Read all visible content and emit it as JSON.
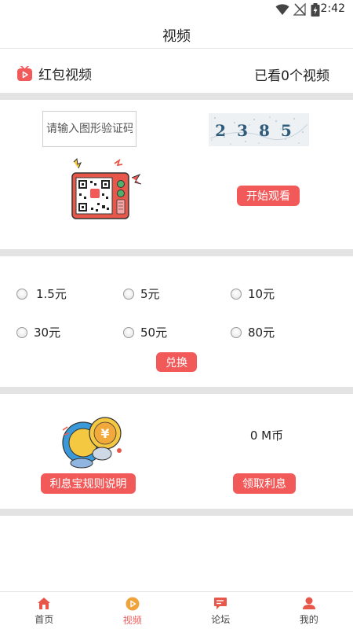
{
  "status_bar": {
    "time": "2:42"
  },
  "header": {
    "title": "视频"
  },
  "brand_row": {
    "label": "红包视频",
    "watched": "已看0个视频"
  },
  "captcha": {
    "placeholder": "请输入图形验证码",
    "code": "2385"
  },
  "buttons": {
    "start_watch": "开始观看",
    "exchange": "兑换",
    "rules": "利息宝规则说明",
    "claim": "领取利息"
  },
  "amount_options": [
    "1.5元",
    "5元",
    "10元",
    "30元",
    "50元",
    "80元"
  ],
  "balance": "0 M币",
  "tabs": [
    {
      "label": "首页",
      "icon": "home-icon"
    },
    {
      "label": "视频",
      "icon": "video-icon"
    },
    {
      "label": "论坛",
      "icon": "forum-icon"
    },
    {
      "label": "我的",
      "icon": "profile-icon"
    }
  ],
  "colors": {
    "accent": "#f25a5a",
    "divider": "#e3e3e3",
    "tab_active": "#f25a5a",
    "tab_icon": "#e8584a"
  }
}
